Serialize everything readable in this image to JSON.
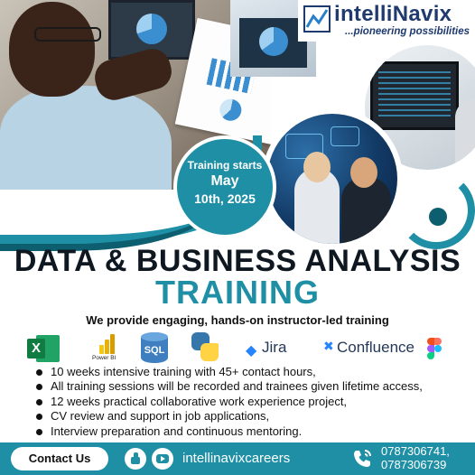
{
  "brand": {
    "name": "intelliNavix",
    "tagline": "...pioneering possibilities"
  },
  "badge": {
    "line1": "Training starts",
    "line2": "May",
    "line3": "10th, 2025"
  },
  "headline": {
    "title": "DATA & BUSINESS ANALYSIS",
    "subtitle": "TRAINING",
    "tagline": "We provide engaging, hands-on instructor-led training"
  },
  "tools": {
    "excel_letter": "X",
    "powerbi_label": "Power BI",
    "sql_label": "SQL",
    "jira_label": "Jira",
    "confluence_label": "Confluence",
    "icons": [
      "excel-icon",
      "powerbi-icon",
      "sql-icon",
      "python-icon",
      "jira-icon",
      "confluence-icon",
      "figma-icon"
    ]
  },
  "bullets": [
    "10 weeks intensive training with 45+ contact hours,",
    "All training sessions will be recorded and trainees given lifetime access,",
    "12 weeks practical collaborative work experience project,",
    "CV review and support in job applications,",
    "Interview preparation and continuous mentoring."
  ],
  "footer": {
    "contact_label": "Contact Us",
    "social_handle": "intellinavixcareers",
    "phone1": "0787306741,",
    "phone2": "0787306739"
  },
  "colors": {
    "accent": "#1f8fa5",
    "accent_dark": "#0d5f70",
    "brand_navy": "#1f3a6e",
    "text": "#111111"
  }
}
